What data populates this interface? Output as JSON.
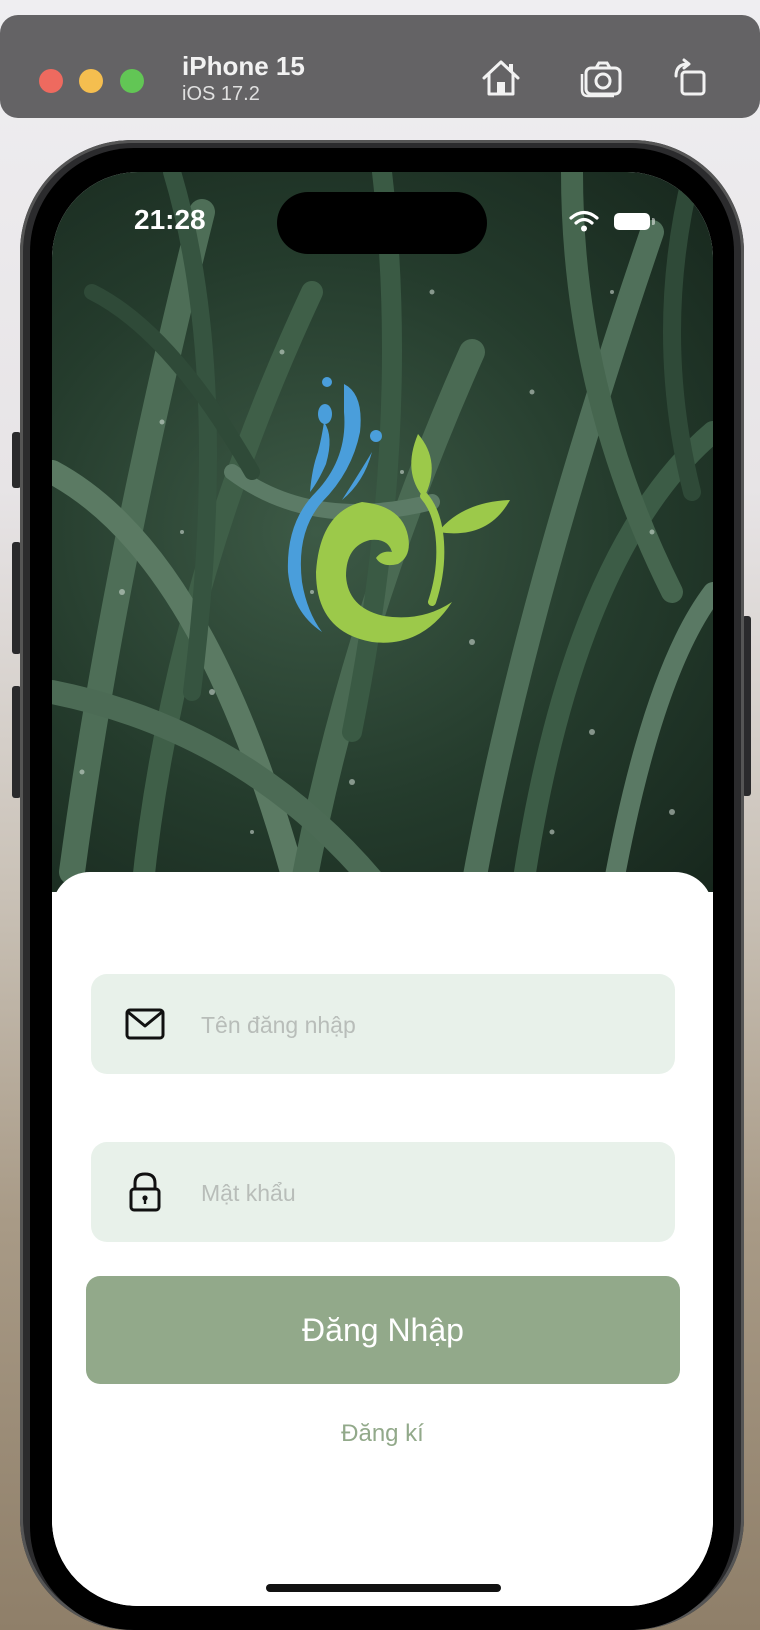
{
  "simulator": {
    "device_name": "iPhone 15",
    "os_version": "iOS 17.2",
    "buttons": [
      "home-icon",
      "screenshot-icon",
      "rotate-icon"
    ]
  },
  "status_bar": {
    "time": "21:28",
    "icons": [
      "wifi-icon",
      "battery-icon"
    ]
  },
  "login": {
    "username_placeholder": "Tên đăng nhập",
    "password_placeholder": "Mật khẩu",
    "login_button": "Đăng Nhập",
    "register_link": "Đăng kí"
  },
  "colors": {
    "accent": "#92a98a",
    "field_background": "#e8f1ea",
    "logo_blue": "#4a9edb",
    "logo_green": "#9cc94a"
  }
}
